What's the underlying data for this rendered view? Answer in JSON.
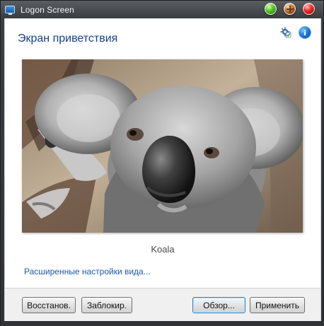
{
  "window": {
    "title": "Logon Screen",
    "controls": [
      "maximize",
      "restore",
      "close"
    ]
  },
  "main": {
    "heading": "Экран приветствия",
    "image_caption": "Koala",
    "advanced_link": "Расширенные настройки вида..."
  },
  "icons": {
    "gear": "settings-checklist-icon",
    "info": "info-icon"
  },
  "buttons": {
    "restore": "Восстанов.",
    "lock": "Заблокир.",
    "browse": "Обзор...",
    "apply": "Применить"
  },
  "colors": {
    "heading": "#163f86",
    "link": "#1c58a8",
    "button_primary_border": "#3c7fb1"
  }
}
